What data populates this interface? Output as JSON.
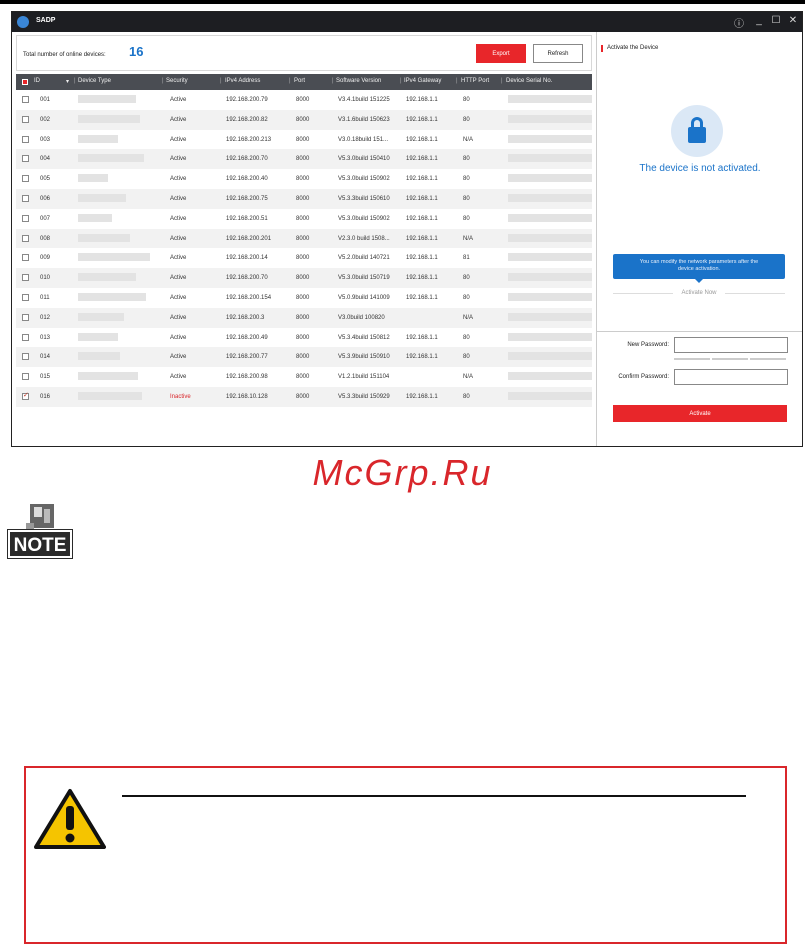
{
  "window": {
    "title": "SADP",
    "controls": [
      "ⓘ",
      "_",
      "☐",
      "✕"
    ]
  },
  "header": {
    "total_label": "Total number of online devices:",
    "total_count": "16",
    "export_label": "Export",
    "refresh_label": "Refresh"
  },
  "table": {
    "columns": [
      "ID",
      "Device Type",
      "Security",
      "IPv4 Address",
      "Port",
      "Software Version",
      "IPv4 Gateway",
      "HTTP Port",
      "Device Serial No."
    ],
    "rows": [
      {
        "id": "001",
        "security": "Active",
        "ip": "192.168.200.79",
        "port": "8000",
        "version": "V3.4.1build 151225",
        "gateway": "192.168.1.1",
        "http": "80",
        "checked": false
      },
      {
        "id": "002",
        "security": "Active",
        "ip": "192.168.200.82",
        "port": "8000",
        "version": "V3.1.6build 150623",
        "gateway": "192.168.1.1",
        "http": "80",
        "checked": false
      },
      {
        "id": "003",
        "security": "Active",
        "ip": "192.168.200.213",
        "port": "8000",
        "version": "V3.0.18build 151...",
        "gateway": "192.168.1.1",
        "http": "N/A",
        "checked": false
      },
      {
        "id": "004",
        "security": "Active",
        "ip": "192.168.200.70",
        "port": "8000",
        "version": "V5.3.0build 150410",
        "gateway": "192.168.1.1",
        "http": "80",
        "checked": false
      },
      {
        "id": "005",
        "security": "Active",
        "ip": "192.168.200.40",
        "port": "8000",
        "version": "V5.3.0build 150902",
        "gateway": "192.168.1.1",
        "http": "80",
        "checked": false
      },
      {
        "id": "006",
        "security": "Active",
        "ip": "192.168.200.75",
        "port": "8000",
        "version": "V5.3.3build 150610",
        "gateway": "192.168.1.1",
        "http": "80",
        "checked": false
      },
      {
        "id": "007",
        "security": "Active",
        "ip": "192.168.200.51",
        "port": "8000",
        "version": "V5.3.0build 150902",
        "gateway": "192.168.1.1",
        "http": "80",
        "checked": false
      },
      {
        "id": "008",
        "security": "Active",
        "ip": "192.168.200.201",
        "port": "8000",
        "version": "V2.3.0 build 1508...",
        "gateway": "192.168.1.1",
        "http": "N/A",
        "checked": false
      },
      {
        "id": "009",
        "security": "Active",
        "ip": "192.168.200.14",
        "port": "8000",
        "version": "V5.2.0build 140721",
        "gateway": "192.168.1.1",
        "http": "81",
        "checked": false
      },
      {
        "id": "010",
        "security": "Active",
        "ip": "192.168.200.70",
        "port": "8000",
        "version": "V5.3.0build 150719",
        "gateway": "192.168.1.1",
        "http": "80",
        "checked": false
      },
      {
        "id": "011",
        "security": "Active",
        "ip": "192.168.200.154",
        "port": "8000",
        "version": "V5.0.9build 141009",
        "gateway": "192.168.1.1",
        "http": "80",
        "checked": false
      },
      {
        "id": "012",
        "security": "Active",
        "ip": "192.168.200.3",
        "port": "8000",
        "version": "V3.0build 100820",
        "gateway": "",
        "http": "N/A",
        "checked": false
      },
      {
        "id": "013",
        "security": "Active",
        "ip": "192.168.200.49",
        "port": "8000",
        "version": "V5.3.4build 150812",
        "gateway": "192.168.1.1",
        "http": "80",
        "checked": false
      },
      {
        "id": "014",
        "security": "Active",
        "ip": "192.168.200.77",
        "port": "8000",
        "version": "V5.3.9build 150910",
        "gateway": "192.168.1.1",
        "http": "80",
        "checked": false
      },
      {
        "id": "015",
        "security": "Active",
        "ip": "192.168.200.98",
        "port": "8000",
        "version": "V1.2.1build 151104",
        "gateway": "",
        "http": "N/A",
        "checked": false
      },
      {
        "id": "016",
        "security": "Inactive",
        "ip": "192.168.10.128",
        "port": "8000",
        "version": "V5.3.3build 150929",
        "gateway": "192.168.1.1",
        "http": "80",
        "checked": true
      }
    ]
  },
  "activate": {
    "title": "Activate the Device",
    "status_text": "The device is not activated.",
    "tooltip_line1": "You can modify the network parameters after the",
    "tooltip_line2": "device activation.",
    "activate_now": "Activate Now",
    "new_password_label": "New Password:",
    "confirm_password_label": "Confirm Password:",
    "activate_button": "Activate"
  },
  "watermark": "McGrp.Ru",
  "note_label": "NOTE",
  "colors": {
    "accent_red": "#e8262a",
    "accent_blue": "#1a73c9",
    "titlebar": "#1d1e22"
  },
  "icons": {
    "note": "note-icon",
    "warning": "warning-triangle-icon",
    "lock": "lock-icon"
  }
}
